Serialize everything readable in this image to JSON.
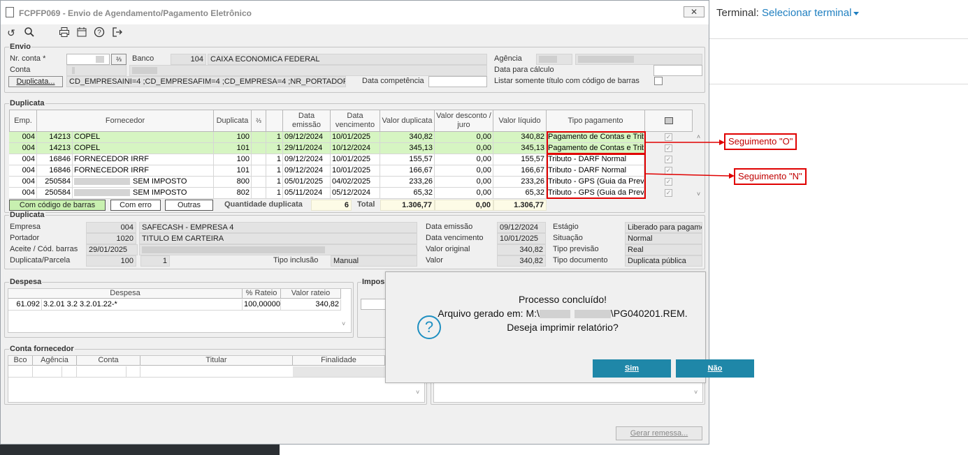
{
  "window": {
    "title": "FCPFP069 - Envio de Agendamento/Pagamento Eletrônico",
    "close": "✕"
  },
  "right_panel": {
    "terminal_label": "Terminal:",
    "terminal_link": "Selecionar terminal"
  },
  "envio": {
    "group": "Envio",
    "nr_conta_label": "Nr. conta *",
    "banco_label": "Banco",
    "banco_code": "104",
    "banco_name": "CAIXA ECONOMICA FEDERAL",
    "conta_label": "Conta",
    "duplicata_btn": "Duplicata...",
    "filter": "CD_EMPRESAINI=4 ;CD_EMPRESAFIM=4 ;CD_EMPRESA=4 ;NR_PORTADORINI=0 ;",
    "data_comp_label": "Data competência",
    "agencia_label": "Agência",
    "data_calc_label": "Data para cálculo",
    "listar_label": "Listar somente título com código de barras"
  },
  "grid": {
    "group": "Duplicata",
    "headers": [
      "Emp.",
      "Fornecedor",
      "Duplicata",
      "⅔",
      "",
      "Data emissão",
      "Data vencimento",
      "Valor duplicata",
      "Valor desconto / juro",
      "Valor líquido",
      "Tipo pagamento"
    ],
    "rows": [
      {
        "emp": "004",
        "code": "14213",
        "name": "COPEL",
        "dup": "100",
        "p": "1",
        "emis": "09/12/2024",
        "venc": "10/01/2025",
        "vdup": "340,82",
        "vdesc": "0,00",
        "vliq": "340,82",
        "tipo": "Pagamento de Contas e Trib"
      },
      {
        "emp": "004",
        "code": "14213",
        "name": "COPEL",
        "dup": "101",
        "p": "1",
        "emis": "29/11/2024",
        "venc": "10/12/2024",
        "vdup": "345,13",
        "vdesc": "0,00",
        "vliq": "345,13",
        "tipo": "Pagamento de Contas e Trib"
      },
      {
        "emp": "004",
        "code": "16846",
        "name": "FORNECEDOR IRRF",
        "dup": "100",
        "p": "1",
        "emis": "09/12/2024",
        "venc": "10/01/2025",
        "vdup": "155,57",
        "vdesc": "0,00",
        "vliq": "155,57",
        "tipo": "Tributo - DARF Normal"
      },
      {
        "emp": "004",
        "code": "16846",
        "name": "FORNECEDOR IRRF",
        "dup": "101",
        "p": "1",
        "emis": "09/12/2024",
        "venc": "10/01/2025",
        "vdup": "166,67",
        "vdesc": "0,00",
        "vliq": "166,67",
        "tipo": "Tributo - DARF Normal"
      },
      {
        "emp": "004",
        "code": "250584",
        "name": "SEM IMPOSTO",
        "dup": "800",
        "p": "1",
        "emis": "05/01/2025",
        "venc": "04/02/2025",
        "vdup": "233,26",
        "vdesc": "0,00",
        "vliq": "233,26",
        "tipo": "Tributo - GPS (Guia da Prev"
      },
      {
        "emp": "004",
        "code": "250584",
        "name": "SEM IMPOSTO",
        "dup": "802",
        "p": "1",
        "emis": "05/11/2024",
        "venc": "05/12/2024",
        "vdup": "65,32",
        "vdesc": "0,00",
        "vliq": "65,32",
        "tipo": "Tributo - GPS (Guia da Prev"
      }
    ],
    "legend_barcode": "Com código de barras",
    "legend_error": "Com erro",
    "legend_other": "Outras",
    "qty_label": "Quantidade duplicata",
    "qty_value": "6",
    "total_label": "Total",
    "total_dup": "1.306,77",
    "total_desc": "0,00",
    "total_liq": "1.306,77"
  },
  "callouts": {
    "o": "Seguimento \"O\"",
    "n": "Seguimento \"N\""
  },
  "detail": {
    "group": "Duplicata",
    "empresa_label": "Empresa",
    "empresa_code": "004",
    "empresa_name": "SAFECASH - EMPRESA 4",
    "portador_label": "Portador",
    "portador_code": "1020",
    "portador_name": "TITULO EM CARTEIRA",
    "aceite_label": "Aceite / Cód. barras",
    "aceite_value": "29/01/2025",
    "dup_parc_label": "Duplicata/Parcela",
    "dup_value": "100",
    "parc_value": "1",
    "tipo_inc_label": "Tipo inclusão",
    "tipo_inc_value": "Manual",
    "data_emissao_label": "Data emissão",
    "data_emissao": "09/12/2024",
    "data_venc_label": "Data vencimento",
    "data_venc": "10/01/2025",
    "valor_orig_label": "Valor original",
    "valor_orig": "340,82",
    "valor_label": "Valor",
    "valor": "340,82",
    "estagio_label": "Estágio",
    "estagio": "Liberado para pagame",
    "situacao_label": "Situação",
    "situacao": "Normal",
    "tipo_prev_label": "Tipo previsão",
    "tipo_prev": "Real",
    "tipo_doc_label": "Tipo documento",
    "tipo_doc": "Duplicata pública"
  },
  "despesa": {
    "group": "Despesa",
    "h_despesa": "Despesa",
    "h_rateio": "% Rateio",
    "h_valor": "Valor rateio",
    "row_code": "61.092",
    "row_desc": "3.2.01 3.2 3.2.01.22-*",
    "row_rateio": "100,00000",
    "row_valor": "340,82"
  },
  "imposto": {
    "group": "Impos"
  },
  "conta_fornecedor": {
    "group": "Conta fornecedor",
    "h_bco": "Bco",
    "h_agencia": "Agência",
    "h_conta": "Conta",
    "h_titular": "Titular",
    "h_finalidade": "Finalidade"
  },
  "footer": {
    "gerar_btn": "Gerar remessa..."
  },
  "dialog": {
    "line1": "Processo concluído!",
    "line2_prefix": "Arquivo gerado em: M:\\",
    "line2_suffix": "\\PG040201.REM.",
    "line3": "Deseja imprimir relatório?",
    "yes": "Sim",
    "no": "Não"
  }
}
